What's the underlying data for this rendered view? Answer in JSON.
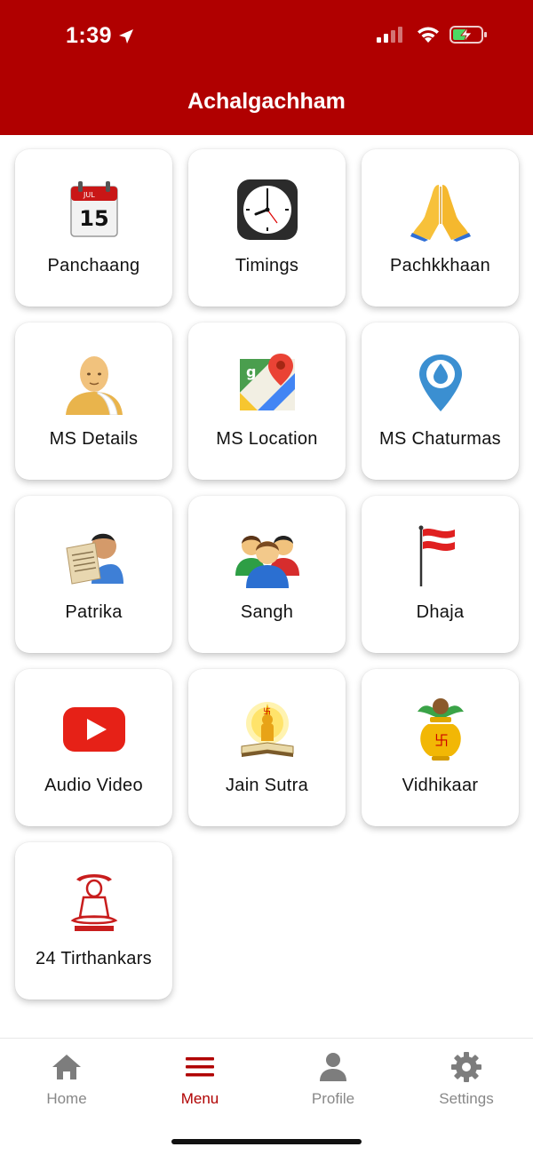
{
  "status_bar": {
    "time": "1:39"
  },
  "header": {
    "title": "Achalgachham",
    "background_color": "#b00000"
  },
  "menu": {
    "items": [
      {
        "label": "Panchaang",
        "icon": "calendar-icon"
      },
      {
        "label": "Timings",
        "icon": "clock-icon"
      },
      {
        "label": "Pachkkhaan",
        "icon": "folded-hands-icon"
      },
      {
        "label": "MS Details",
        "icon": "monk-icon"
      },
      {
        "label": "MS Location",
        "icon": "map-icon"
      },
      {
        "label": "MS Chaturmas",
        "icon": "location-pin-icon"
      },
      {
        "label": "Patrika",
        "icon": "newspaper-reader-icon"
      },
      {
        "label": "Sangh",
        "icon": "group-icon"
      },
      {
        "label": "Dhaja",
        "icon": "flag-icon"
      },
      {
        "label": "Audio Video",
        "icon": "youtube-icon"
      },
      {
        "label": "Jain Sutra",
        "icon": "scripture-icon"
      },
      {
        "label": "Vidhikaar",
        "icon": "kalash-icon"
      },
      {
        "label": "24 Tirthankars",
        "icon": "tirthankar-icon"
      }
    ]
  },
  "bottom_nav": {
    "items": [
      {
        "label": "Home",
        "icon": "home-icon"
      },
      {
        "label": "Menu",
        "icon": "hamburger-menu-icon"
      },
      {
        "label": "Profile",
        "icon": "person-icon"
      },
      {
        "label": "Settings",
        "icon": "gear-icon"
      }
    ],
    "active": "Menu",
    "active_color": "#b00000"
  }
}
